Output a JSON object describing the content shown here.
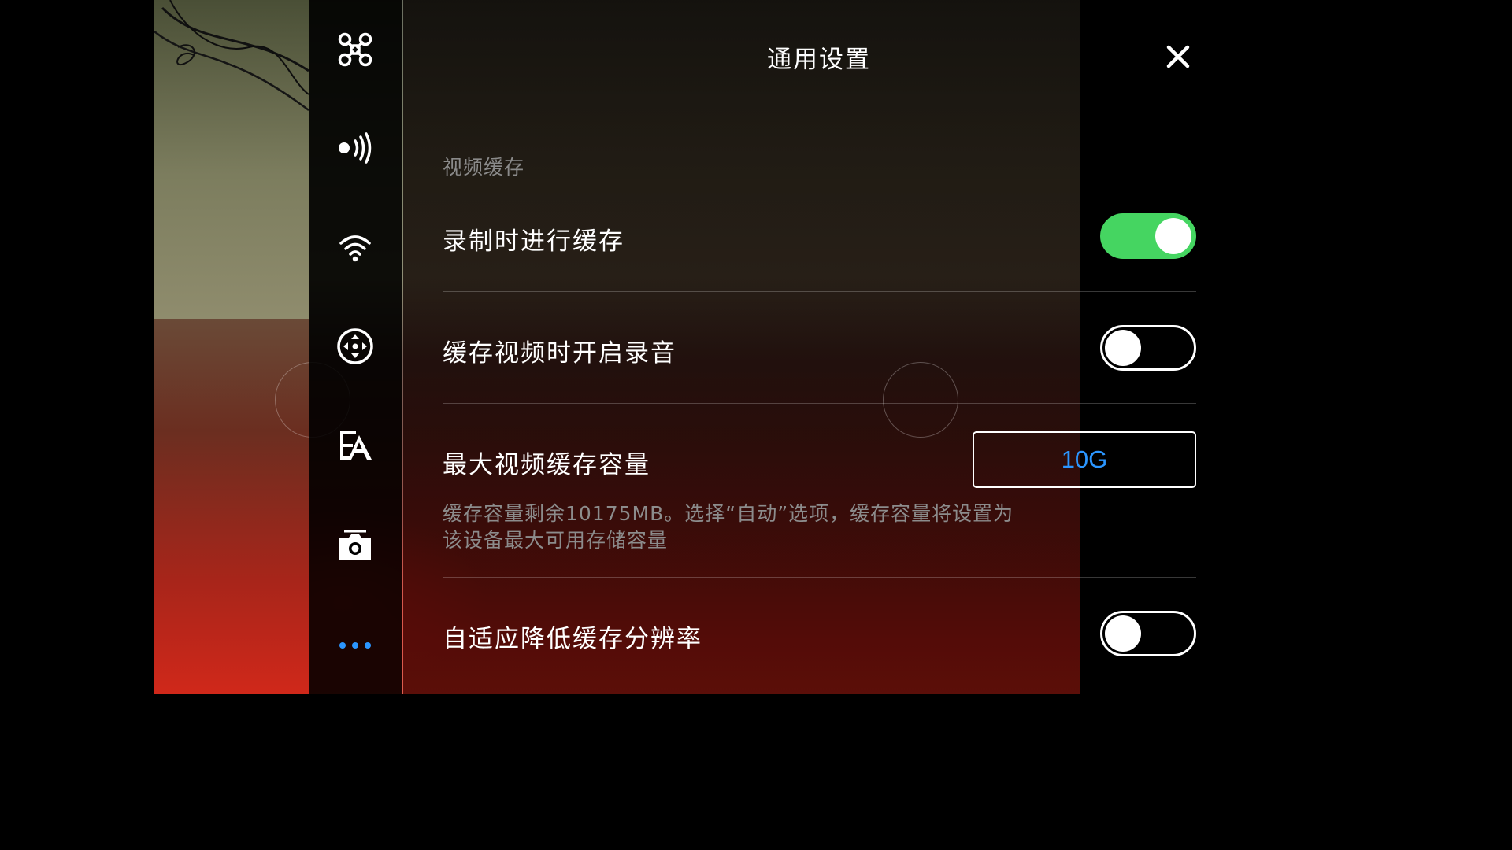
{
  "header": {
    "title": "通用设置"
  },
  "sidebar": {
    "items": [
      {
        "icon": "aircraft-icon"
      },
      {
        "icon": "signal-icon"
      },
      {
        "icon": "wifi-icon"
      },
      {
        "icon": "gimbal-icon"
      },
      {
        "icon": "language-icon"
      },
      {
        "icon": "camera-icon"
      },
      {
        "icon": "more-icon",
        "active": true
      }
    ],
    "active_color": "#2b96ff"
  },
  "section": {
    "label": "视频缓存"
  },
  "settings": {
    "cache_while_recording": {
      "label": "录制时进行缓存",
      "enabled": true
    },
    "record_audio": {
      "label": "缓存视频时开启录音",
      "enabled": false
    },
    "max_cache": {
      "label": "最大视频缓存容量",
      "value": "10G",
      "hint_line1": "缓存容量剩余10175MB。选择“自动”选项，缓存容量将设置为",
      "hint_line2": "该设备最大可用存储容量"
    },
    "adaptive_resolution": {
      "label": "自适应降低缓存分辨率",
      "enabled": false
    }
  },
  "colors": {
    "toggle_on": "#45d561",
    "value_text": "#2b96ff"
  }
}
